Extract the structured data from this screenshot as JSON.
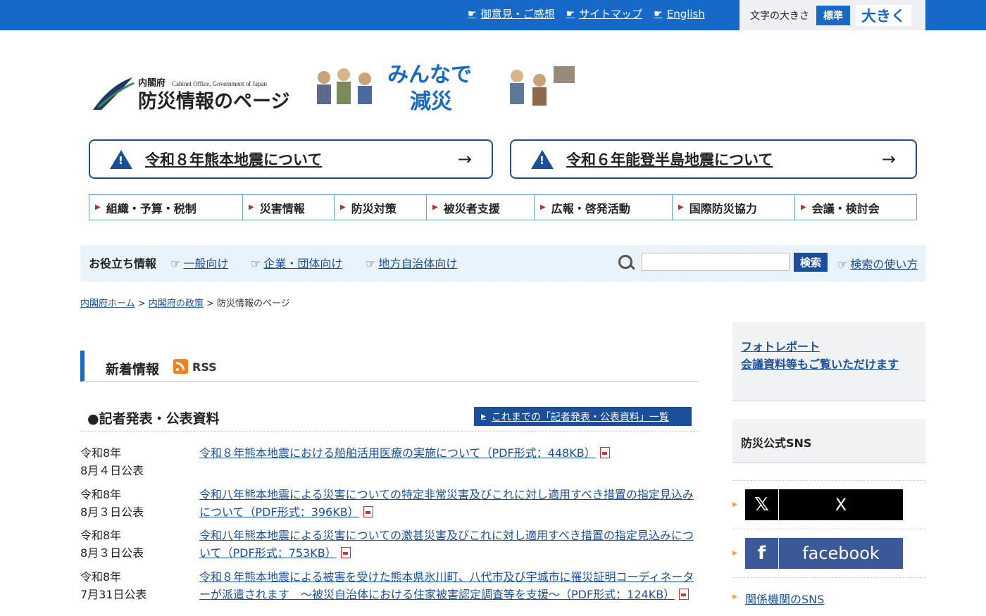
{
  "topbar": {
    "links": [
      "御意見・ご感想",
      "サイトマップ",
      "English"
    ],
    "fontsize_label": "文字の大きさ",
    "fontsize_standard": "標準",
    "fontsize_large": "大きく"
  },
  "logo": {
    "org": "内閣府",
    "org_en": "Cabinet Office, Government of Japan",
    "title": "防災情報のページ",
    "slogan_line1": "みんなで",
    "slogan_line2": "減災"
  },
  "banners": [
    "令和８年熊本地震について",
    "令和６年能登半島地震について"
  ],
  "gnav": [
    "組織・予算・税制",
    "災害情報",
    "防災対策",
    "被災者支援",
    "広報・啓発活動",
    "国際防災協力",
    "会議・検討会"
  ],
  "useful": {
    "title": "お役立ち情報",
    "links": [
      "一般向け",
      "企業・団体向け",
      "地方自治体向け"
    ],
    "search_button": "検索",
    "search_help": "検索の使い方"
  },
  "breadcrumb": {
    "home": "内閣府ホーム",
    "policy": "内閣府の政策",
    "current": "防災情報のページ",
    "sep": ">"
  },
  "news": {
    "title": "新着情報",
    "rss": "RSS",
    "press_title": "●記者発表・公表資料",
    "press_all": "これまでの「記者発表・公表資料」一覧",
    "items": [
      {
        "date": "令和8年\n8月４日公表",
        "title": "令和８年熊本地震における船舶活用医療の実施について（PDF形式：448KB）"
      },
      {
        "date": "令和8年\n8月３日公表",
        "title": "令和八年熊本地震による災害についての特定非常災害及びこれに対し適用すべき措置の指定見込みについて（PDF形式：396KB）"
      },
      {
        "date": "令和8年\n8月３日公表",
        "title": "令和八年熊本地震による災害についての激甚災害及びこれに対し適用すべき措置の指定見込みについて（PDF形式：753KB）"
      },
      {
        "date": "令和8年\n7月31日公表",
        "title": "令和８年熊本地震による被害を受けた熊本県氷川町、八代市及び宇城市に罹災証明コーディネーターが派遣されます　～被災自治体における住家被害認定調査等を支援～（PDF形式：124KB）"
      }
    ]
  },
  "sidebar": {
    "photo_line1": "フォトレポート",
    "photo_line2": "会議資料等もご覧いただけます",
    "sns_title": "防災公式SNS",
    "x_label": "X",
    "facebook_label": "facebook",
    "related_sns": "関係機関のSNS"
  },
  "colors": {
    "header_blue": "#1769c7",
    "navy": "#1a4f9c",
    "alert_red": "#c0282d"
  }
}
